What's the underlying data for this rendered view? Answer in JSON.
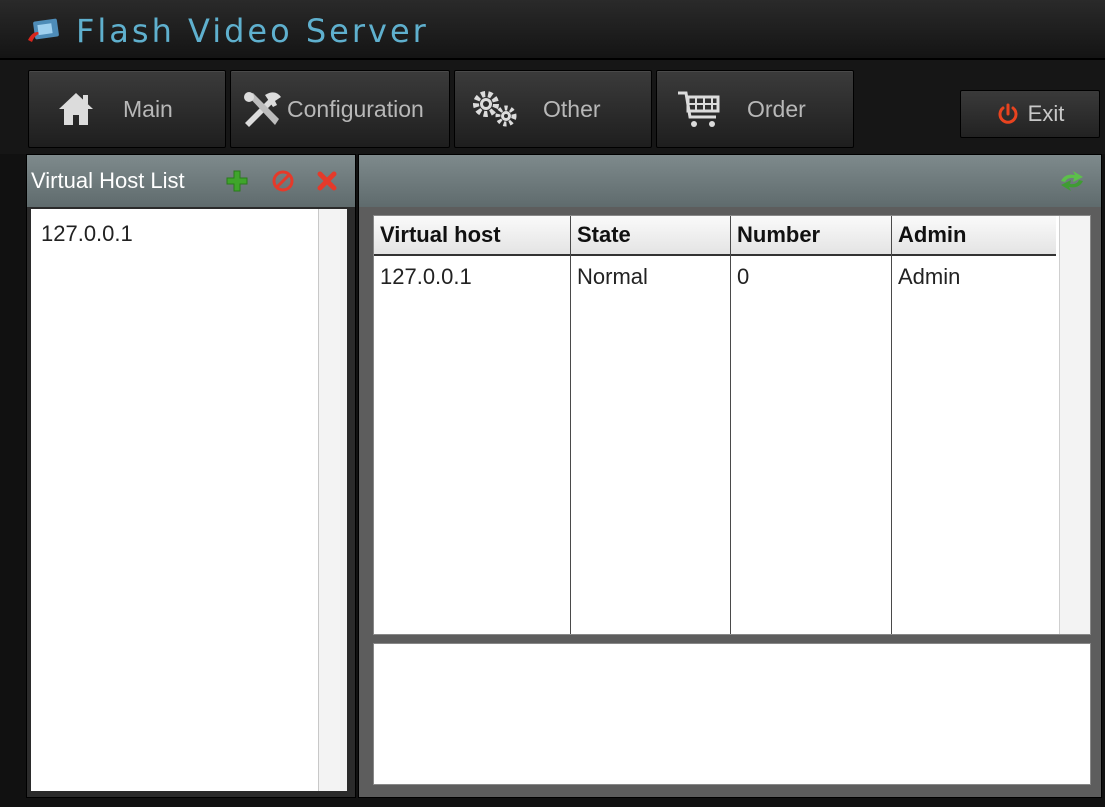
{
  "app": {
    "title": "Flash Video Server"
  },
  "nav": {
    "main": "Main",
    "configuration": "Configuration",
    "other": "Other",
    "order": "Order",
    "exit": "Exit"
  },
  "left_panel": {
    "title": "Virtual Host List",
    "items": [
      "127.0.0.1"
    ]
  },
  "table": {
    "columns": [
      "Virtual host",
      "State",
      "Number",
      "Admin"
    ],
    "rows": [
      [
        "127.0.0.1",
        "Normal",
        "0",
        "Admin"
      ]
    ]
  },
  "colors": {
    "title_text": "#5fb0ce",
    "panel_header": "#6f7b7d",
    "add_icon": "#3fa52b",
    "stop_icon": "#e53a2a",
    "delete_icon": "#e53a2a",
    "exit_icon": "#e8431f"
  },
  "icons": {
    "logo": "flash-video-server-logo",
    "main": "home-icon",
    "configuration": "tools-icon",
    "other": "gears-icon",
    "order": "cart-icon",
    "exit": "power-icon",
    "add": "plus-icon",
    "stop": "stop-icon",
    "delete": "delete-icon",
    "refresh": "refresh-icon"
  }
}
